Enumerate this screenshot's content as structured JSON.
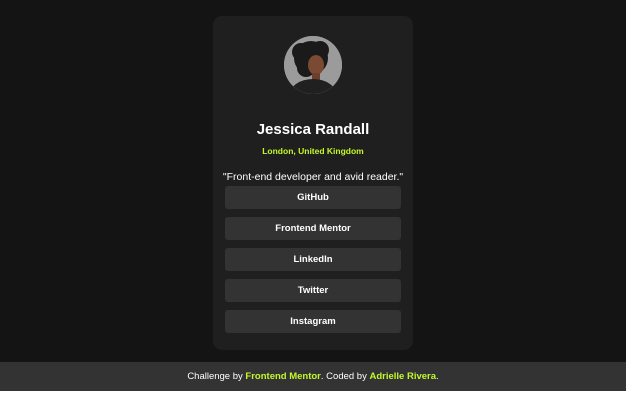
{
  "profile": {
    "name": "Jessica Randall",
    "location": "London, United Kingdom",
    "bio": "\"Front-end developer and avid reader.\""
  },
  "links": [
    {
      "label": "GitHub"
    },
    {
      "label": "Frontend Mentor"
    },
    {
      "label": "LinkedIn"
    },
    {
      "label": "Twitter"
    },
    {
      "label": "Instagram"
    }
  ],
  "footer": {
    "prefix": "Challenge by ",
    "challenge_link": "Frontend Mentor",
    "middle": ". Coded by ",
    "author_link": "Adrielle Rivera",
    "suffix": "."
  },
  "colors": {
    "background": "#141414",
    "card": "#1f1f1f",
    "button": "#333333",
    "accent": "#c4f82a"
  }
}
